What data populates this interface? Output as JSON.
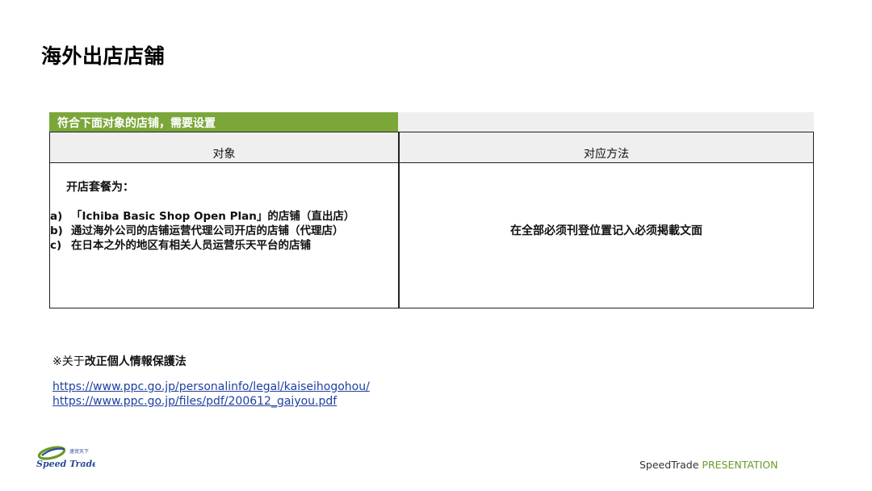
{
  "page": {
    "title": "海外出店店舗"
  },
  "band": {
    "label": "符合下面对象的店铺，需要设置"
  },
  "table": {
    "headers": [
      "对象",
      "对应方法"
    ],
    "left": {
      "heading": "开店套餐为：",
      "items": [
        {
          "marker": "a)",
          "text": "「Ichiba Basic Shop Open Plan」的店铺（直出店）"
        },
        {
          "marker": "b)",
          "text": "通过海外公司的店铺运营代理公司开店的店铺（代理店）"
        },
        {
          "marker": "c)",
          "text": "在日本之外的地区有相关人员运营乐天平台的店铺"
        }
      ]
    },
    "right": {
      "text": "在全部必须刊登位置记入必须掲載文面"
    }
  },
  "privacy": {
    "prefix": "※关于",
    "bold": "改正個人情報保護法",
    "links": [
      "https://www.ppc.go.jp/personalinfo/legal/kaiseihogohou/",
      "https://www.ppc.go.jp/files/pdf/200612_gaiyou.pdf"
    ]
  },
  "logo": {
    "small_text": "速贸天下",
    "brand": "Speed Trade"
  },
  "footer": {
    "brand": "SpeedTrade",
    "label": "PRESENTATION"
  },
  "colors": {
    "accent_green": "#7ba73a",
    "link_blue": "#1f3f9f",
    "header_gray": "#efefef"
  }
}
